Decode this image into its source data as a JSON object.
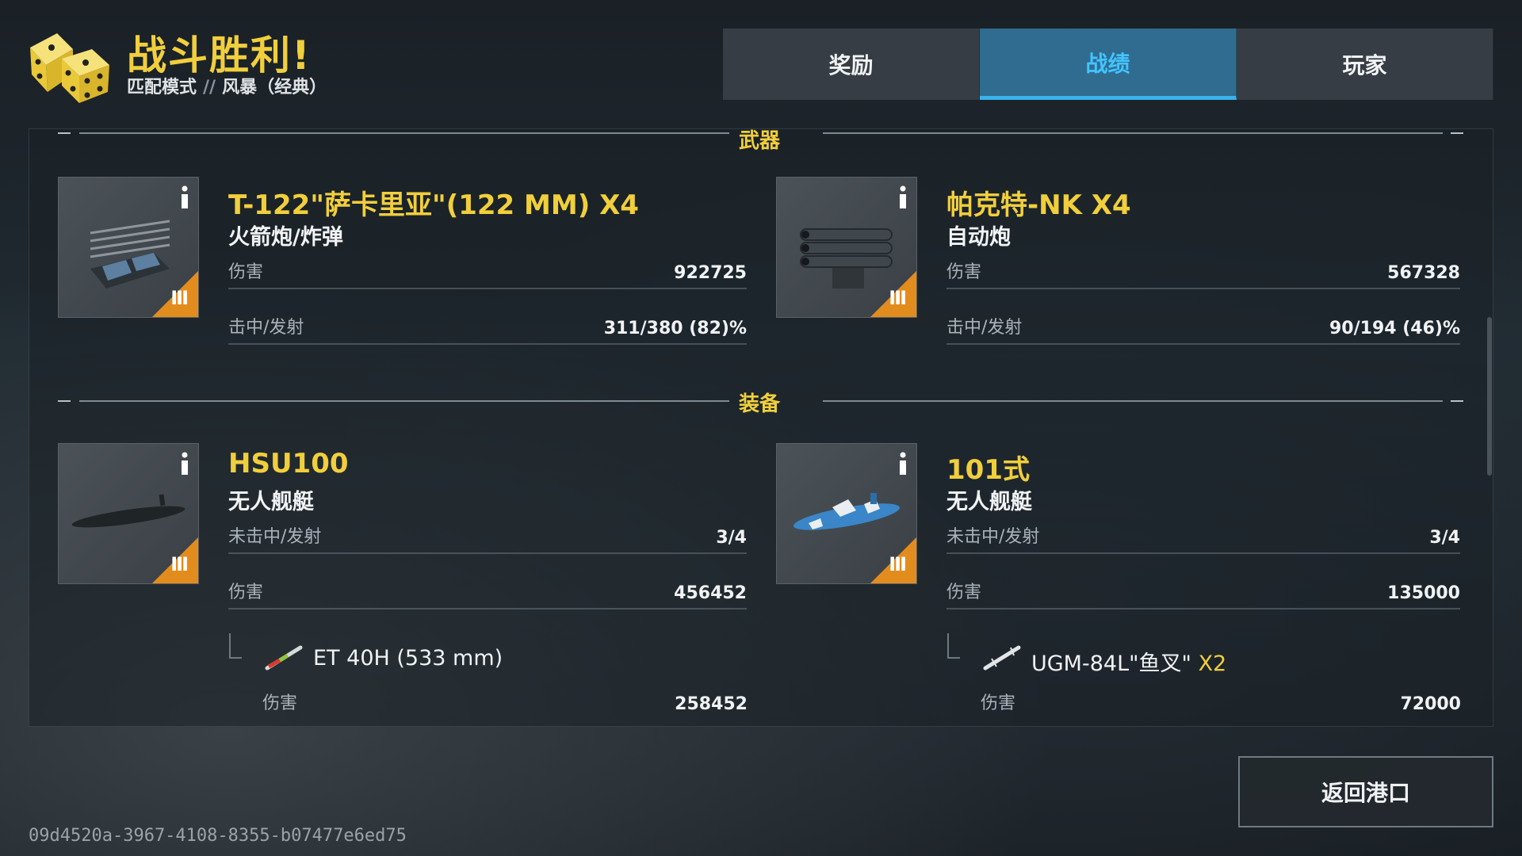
{
  "header": {
    "title": "战斗胜利!",
    "mode": "匹配模式",
    "separator": "//",
    "map": "风暴（经典）"
  },
  "tabs": [
    {
      "label": "奖励",
      "active": false
    },
    {
      "label": "战绩",
      "active": true
    },
    {
      "label": "玩家",
      "active": false
    }
  ],
  "sections": {
    "weapons_title": "武器",
    "equipment_title": "装备"
  },
  "weapons": [
    {
      "name": "T-122\"萨卡里亚\"(122 MM) X4",
      "type": "火箭炮/炸弹",
      "tier": "III",
      "stats": [
        {
          "label": "伤害",
          "value": "922725"
        },
        {
          "label": "击中/发射",
          "value": "311/380 (82)%"
        }
      ]
    },
    {
      "name": "帕克特-NK X4",
      "type": "自动炮",
      "tier": "III",
      "stats": [
        {
          "label": "伤害",
          "value": "567328"
        },
        {
          "label": "击中/发射",
          "value": "90/194 (46)%"
        }
      ]
    }
  ],
  "equipment": [
    {
      "name": "HSU100",
      "type": "无人舰艇",
      "tier": "III",
      "stats": [
        {
          "label": "未击中/发射",
          "value": "3/4"
        },
        {
          "label": "伤害",
          "value": "456452"
        }
      ],
      "sub_item": {
        "name": "ET 40H (533 mm)",
        "multiplier": "",
        "stat_label": "伤害",
        "stat_value": "258452"
      }
    },
    {
      "name": "101式",
      "type": "无人舰艇",
      "tier": "III",
      "stats": [
        {
          "label": "未击中/发射",
          "value": "3/4"
        },
        {
          "label": "伤害",
          "value": "135000"
        }
      ],
      "sub_item": {
        "name": "UGM-84L\"鱼叉\"",
        "multiplier": "X2",
        "stat_label": "伤害",
        "stat_value": "72000"
      }
    }
  ],
  "footer": {
    "return_label": "返回港口",
    "session_id": "09d4520a-3967-4108-8355-b07477e6ed75"
  },
  "colors": {
    "accent_yellow": "#f1cf3c",
    "active_tab_blue": "#39b2ec",
    "tier_orange": "#e38c1e"
  }
}
